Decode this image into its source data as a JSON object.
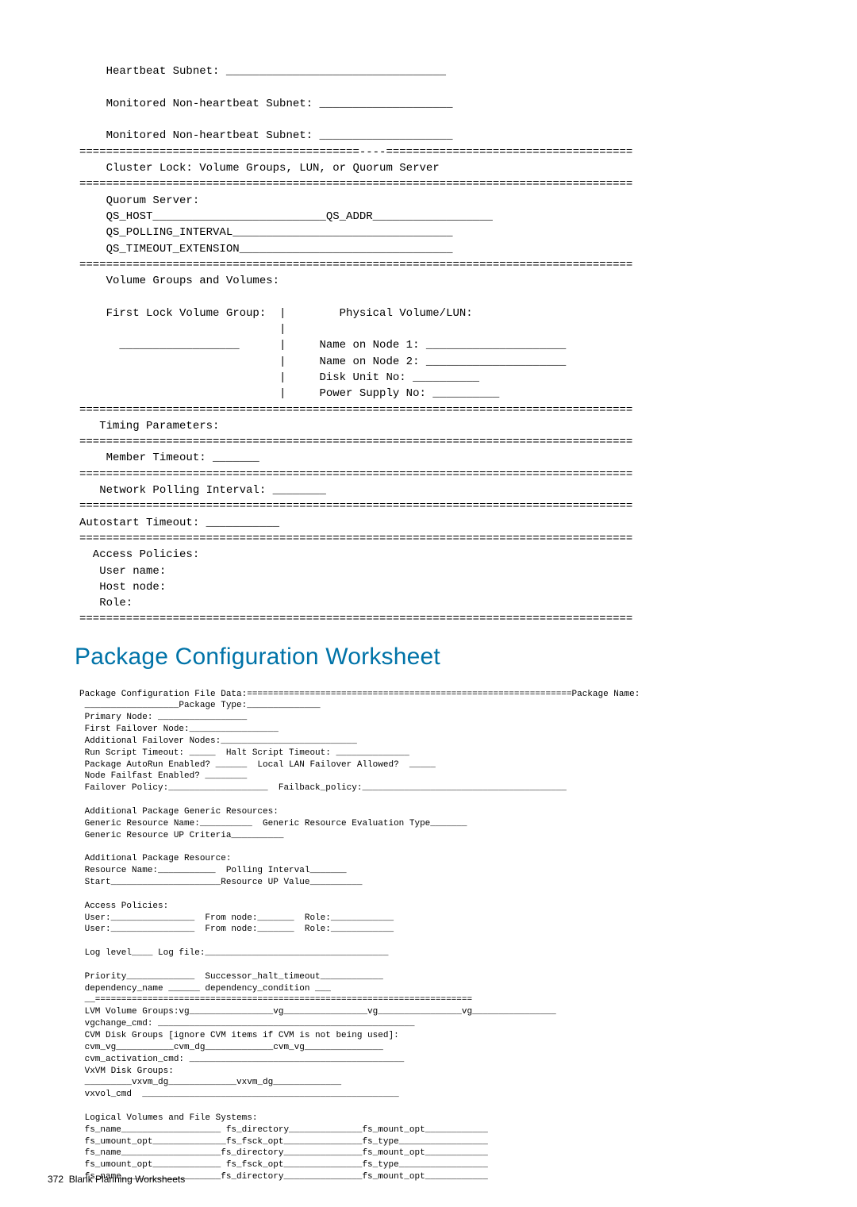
{
  "cluster": {
    "heartbeat_subnet_line": "    Heartbeat Subnet: _________________________________",
    "mon_nonhb_subnet_line1": "    Monitored Non-heartbeat Subnet: ____________________",
    "mon_nonhb_subnet_line2": "    Monitored Non-heartbeat Subnet: ____________________",
    "sep_dash": "==========================================----=====================================",
    "cluster_lock_line": "    Cluster Lock: Volume Groups, LUN, or Quorum Server",
    "sep_eq": "===================================================================================",
    "quorum_server_hdr": "    Quorum Server:",
    "qs_host_addr_line": "    QS_HOST__________________________QS_ADDR__________________",
    "qs_polling_line": "    QS_POLLING_INTERVAL_________________________________",
    "qs_timeout_line": "    QS_TIMEOUT_EXTENSION________________________________",
    "vg_hdr": "    Volume Groups and Volumes:",
    "first_lock_line": "    First Lock Volume Group:  |        Physical Volume/LUN:",
    "pipe_only_line": "                              |",
    "blank_name1_line": "      __________________      |     Name on Node 1: _____________________",
    "name2_line": "                              |     Name on Node 2: _____________________",
    "disk_unit_line": "                              |     Disk Unit No: __________",
    "power_supply_line": "                              |     Power Supply No: __________",
    "timing_hdr": "   Timing Parameters:",
    "member_timeout_line": "    Member Timeout: _______",
    "network_polling_line": "   Network Polling Interval: ________",
    "autostart_line": "Autostart Timeout: ___________",
    "access_hdr": "  Access Policies:",
    "user_name_line": "   User name:",
    "host_node_line": "   Host node:",
    "role_line": "   Role:"
  },
  "section_title": "Package Configuration Worksheet",
  "pkg": {
    "pkg_file_data_line": "Package Configuration File Data:==============================================================Package Name:",
    "pkg_type_line": " __________________Package Type:______________",
    "primary_node_line": " Primary Node: _________________",
    "first_failover_line": " First Failover Node:_________________",
    "addl_failover_line": " Additional Failover Nodes:__________________________",
    "run_halt_line": " Run Script Timeout: _____  Halt Script Timeout: ______________",
    "autorun_line": " Package AutoRun Enabled? ______  Local LAN Failover Allowed?  _____",
    "failfast_line": " Node Failfast Enabled? ________",
    "failover_policy_line": " Failover Policy:___________________  Failback_policy:_______________________________________",
    "blank": "",
    "addl_gen_res_hdr": " Additional Package Generic Resources:",
    "gen_res_name_line": " Generic Resource Name:__________  Generic Resource Evaluation Type_______",
    "gen_res_up_line": " Generic Resource UP Criteria__________",
    "addl_pkg_res_hdr": " Additional Package Resource:",
    "res_name_poll_line": " Resource Name:___________  Polling Interval_______",
    "start_res_up_line": " Start_____________________Resource UP Value__________",
    "access_policies_hdr": " Access Policies:",
    "user_line1": " User:________________  From node:_______  Role:____________",
    "user_line2": " User:________________  From node:_______  Role:____________",
    "log_line": " Log level____ Log file:___________________________________",
    "priority_line": " Priority_____________  Successor_halt_timeout____________",
    "dep_line": " dependency_name ______ dependency_condition ___",
    "pkg_sep": " __========================================================================",
    "lvm_vg_line": " LVM Volume Groups:vg________________vg________________vg________________vg________________",
    "vgchange_line": " vgchange_cmd: _________________________________________________",
    "cvm_dg_line": " CVM Disk Groups [ignore CVM items if CVM is not being used]:",
    "cvm_vg_line": " cvm_vg___________cvm_dg_____________cvm_vg_______________",
    "cvm_act_line": " cvm_activation_cmd: _________________________________________",
    "vxvm_hdr": " VxVM Disk Groups:",
    "vxvm_dg_line": " _________vxvm_dg_____________vxvm_dg_____________",
    "vxvol_line": " vxvol_cmd  _________________________________________________",
    "log_fs_hdr": " Logical Volumes and File Systems:",
    "fs_line_a1": " fs_name___________________ fs_directory______________fs_mount_opt____________",
    "fs_line_a2": " fs_umount_opt______________fs_fsck_opt_______________fs_type_________________",
    "fs_line_b1": " fs_name___________________fs_directory_______________fs_mount_opt____________",
    "fs_line_b2": " fs_umount_opt_____________ fs_fsck_opt_______________fs_type_________________",
    "fs_line_c1": " fs_name___________________fs_directory_______________fs_mount_opt____________"
  },
  "footer": {
    "page_number": "372",
    "section": "Blank Planning Worksheets"
  }
}
